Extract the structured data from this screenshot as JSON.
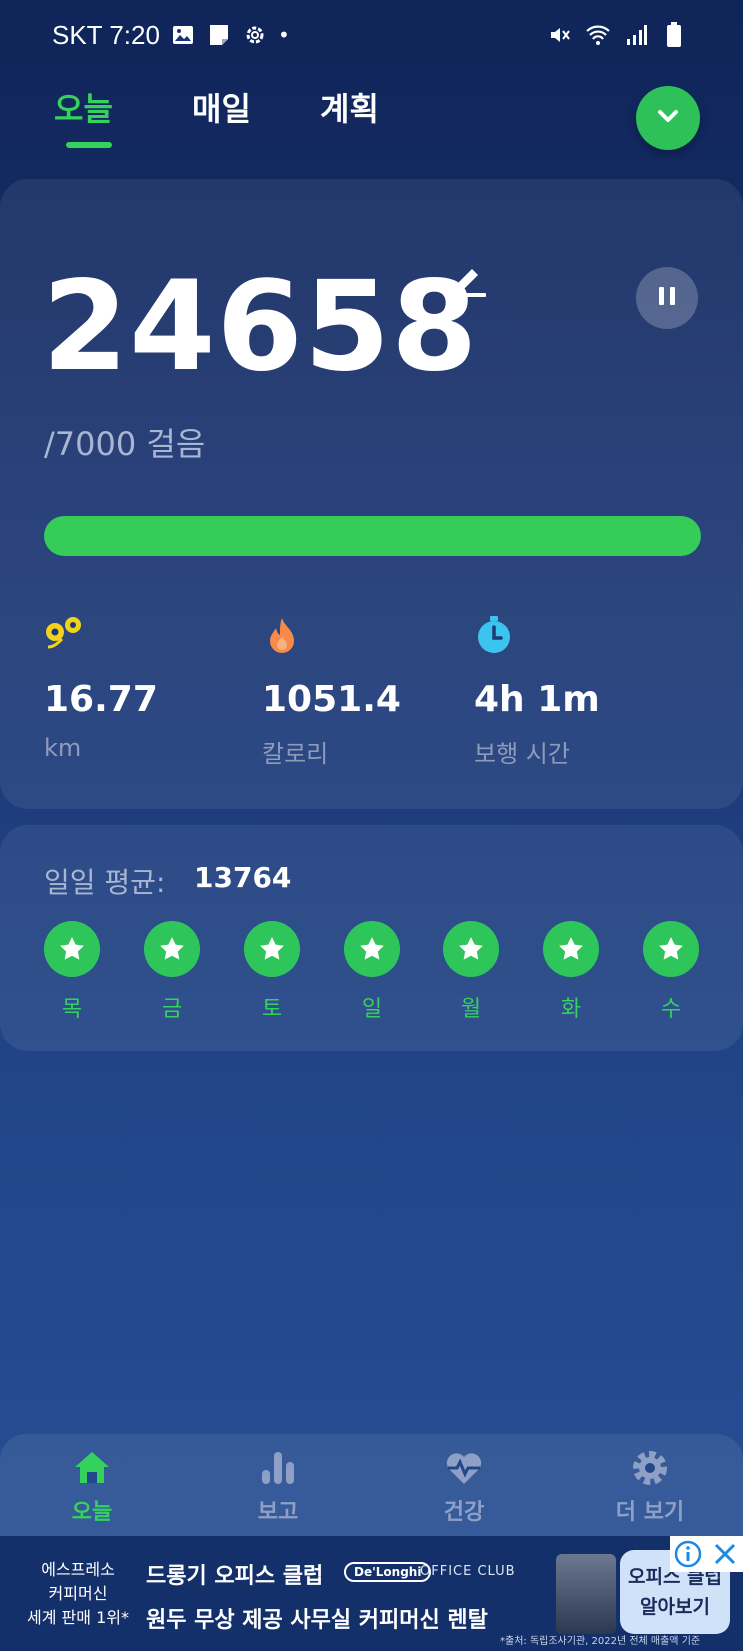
{
  "status_bar": {
    "carrier_time": "SKT 7:20",
    "dot": "•",
    "icons_left": [
      "image-icon",
      "note-icon",
      "gear-icon"
    ],
    "icons_right": [
      "mute-icon",
      "wifi-icon",
      "signal-icon",
      "battery-icon"
    ]
  },
  "top_tabs": {
    "items": [
      {
        "label": "오늘",
        "active": true
      },
      {
        "label": "매일",
        "active": false
      },
      {
        "label": "계획",
        "active": false
      }
    ]
  },
  "today": {
    "steps": "24658",
    "goal": "/7000 걸음",
    "progress_percent": 100,
    "stats": [
      {
        "icon": "distance-icon",
        "value": "16.77",
        "label": "km"
      },
      {
        "icon": "flame-icon",
        "value": "1051.4",
        "label": "칼로리"
      },
      {
        "icon": "stopwatch-icon",
        "value": "4h 1m",
        "label": "보행 시간"
      }
    ]
  },
  "average": {
    "label": "일일 평균:",
    "value": "13764",
    "days": [
      {
        "label": "목",
        "achieved": true
      },
      {
        "label": "금",
        "achieved": true
      },
      {
        "label": "토",
        "achieved": true
      },
      {
        "label": "일",
        "achieved": true
      },
      {
        "label": "월",
        "achieved": true
      },
      {
        "label": "화",
        "achieved": true
      },
      {
        "label": "수",
        "achieved": true
      }
    ]
  },
  "bottom_nav": {
    "items": [
      {
        "label": "오늘",
        "icon": "home-icon",
        "active": true
      },
      {
        "label": "보고",
        "icon": "bar-chart-icon",
        "active": false
      },
      {
        "label": "건강",
        "icon": "heart-pulse-icon",
        "active": false
      },
      {
        "label": "더 보기",
        "icon": "settings-icon",
        "active": false
      }
    ]
  },
  "ad": {
    "left_line1": "에스프레소",
    "left_line2": "커피머신",
    "left_line3": "세계 판매 1위*",
    "title": "드롱기 오피스 클럽",
    "brand": "De'Longhi",
    "brand2": "OFFICE CLUB",
    "subtitle": "원두 무상 제공 사무실 커피머신 렌탈",
    "cta_line1": "오피스 클럽",
    "cta_line2": "알아보기",
    "footnote": "*출처: 독립조사기관, 2022년 전체 매출액 기준"
  },
  "colors": {
    "accent": "#35d15d",
    "background_top": "#0f2458",
    "background_bottom": "#284f95",
    "distance_icon": "#f2d21b",
    "flame_icon": "#f58a4a",
    "stopwatch_icon": "#3cc4f0"
  }
}
